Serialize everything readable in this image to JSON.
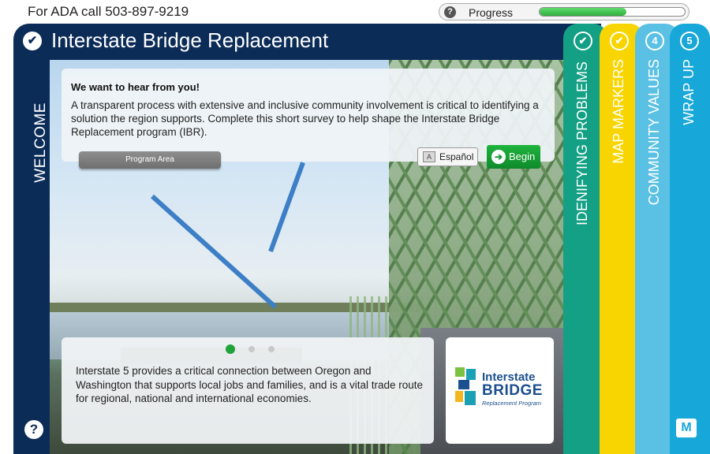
{
  "header": {
    "ada_text": "For ADA call 503-897-9219",
    "progress": {
      "label": "Progress",
      "help_icon": "question-icon",
      "value_fraction": 0.6
    }
  },
  "main": {
    "title": "Interstate Bridge Replacement",
    "welcome_label": "WELCOME",
    "hero": {
      "heading": "We want to hear from you!",
      "body": "A transparent process with extensive and inclusive community involvement is critical to identifying a solution the region supports. Complete this short survey to help shape the Interstate Bridge Replacement program (IBR).",
      "program_area_label": "Program Area",
      "espanol_label": "Español",
      "begin_label": "Begin"
    },
    "carousel": {
      "dots": 3,
      "active_index": 0
    },
    "info_text": "Interstate 5 provides a critical connection between Oregon and Washington that supports local jobs and families, and is a vital trade route for regional, national and international economies.",
    "logo": {
      "line1": "Interstate",
      "line2": "BRIDGE",
      "line3": "Replacement Program"
    }
  },
  "tabs": [
    {
      "badge": "✔",
      "label": "IDENIFYING PROBLEMS",
      "color": "#14a085"
    },
    {
      "badge": "✔",
      "label": "MAP MARKERS",
      "color": "#f8d500"
    },
    {
      "badge": "4",
      "label": "COMMUNITY VALUES",
      "color": "#5bc1e4"
    },
    {
      "badge": "5",
      "label": "WRAP UP",
      "color": "#17a7d9"
    }
  ],
  "colors": {
    "navy": "#0c2c58",
    "green_button": "#129331"
  }
}
